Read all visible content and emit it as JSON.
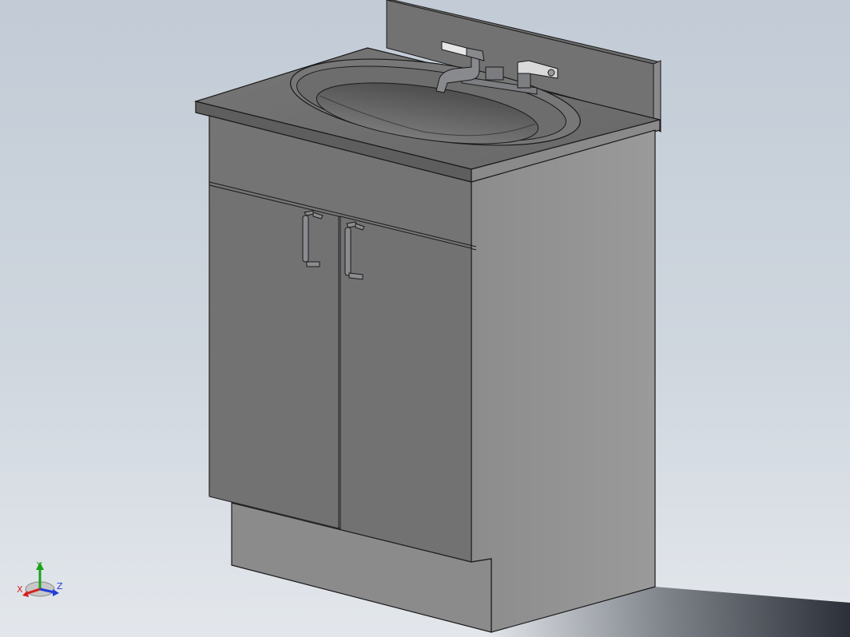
{
  "app": {
    "view": "isometric",
    "background_gradient": [
      "#c2cbd6",
      "#e3e7ec"
    ]
  },
  "model": {
    "name": "bathroom-vanity",
    "parts": [
      "backsplash",
      "countertop",
      "sink-basin",
      "faucet",
      "cabinet-body",
      "left-door",
      "right-door",
      "door-handles",
      "toe-kick"
    ],
    "colors": {
      "cabinet_front": "#747474",
      "cabinet_side": "#919191",
      "countertop_top": "#6f6f6f",
      "countertop_edge": "#5e5e5e",
      "basin_inner": "#636363",
      "faucet": "#888a8d",
      "edge_lines": "#1a1a1a",
      "floor_shadow": "#2b3038"
    }
  },
  "triad": {
    "x_label": "X",
    "y_label": "Y",
    "z_label": "Z",
    "x_color": "#d62020",
    "y_color": "#1aa31a",
    "z_color": "#1f3fd6"
  }
}
